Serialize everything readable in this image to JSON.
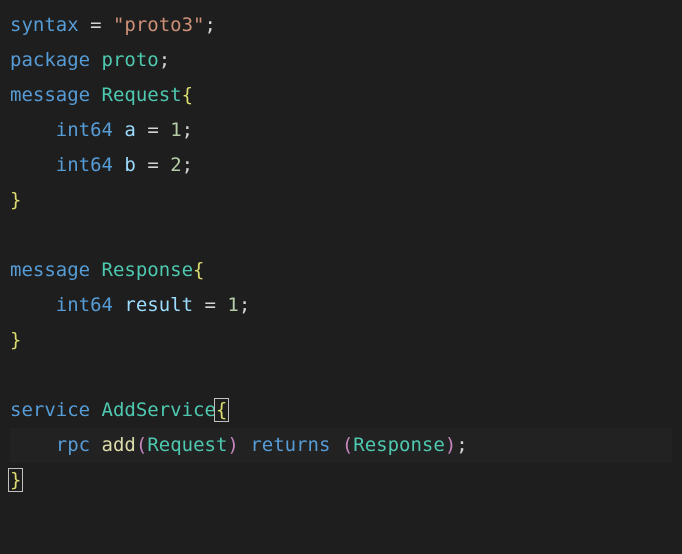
{
  "code": {
    "lines": {
      "l1": {
        "syntax": "syntax",
        "eq": " = ",
        "str": "\"proto3\"",
        "semi": ";"
      },
      "l2": {
        "package": "package",
        "sp": " ",
        "name": "proto",
        "semi": ";"
      },
      "l3": {
        "message": "message",
        "sp": " ",
        "name": "Request",
        "brace": "{"
      },
      "l4": {
        "indent": "    ",
        "type": "int64",
        "sp": " ",
        "field": "a",
        "eq": " = ",
        "num": "1",
        "semi": ";"
      },
      "l5": {
        "indent": "    ",
        "type": "int64",
        "sp": " ",
        "field": "b",
        "eq": " = ",
        "num": "2",
        "semi": ";"
      },
      "l6": {
        "brace": "}"
      },
      "l7": {
        "blank": ""
      },
      "l8": {
        "message": "message",
        "sp": " ",
        "name": "Response",
        "brace": "{"
      },
      "l9": {
        "indent": "    ",
        "type": "int64",
        "sp": " ",
        "field": "result",
        "eq": " = ",
        "num": "1",
        "semi": ";"
      },
      "l10": {
        "brace": "}"
      },
      "l11": {
        "blank": ""
      },
      "l12": {
        "service": "service",
        "sp": " ",
        "name": "AddService",
        "brace": "{"
      },
      "l13": {
        "indent": "    ",
        "rpc": "rpc",
        "sp": " ",
        "method": "add",
        "lp": "(",
        "req": "Request",
        "rp": ")",
        "sp2": " ",
        "returns": "returns",
        "sp3": " ",
        "lp2": "(",
        "resp": "Response",
        "rp2": ")",
        "semi": ";"
      },
      "l14": {
        "brace": "}"
      }
    }
  }
}
